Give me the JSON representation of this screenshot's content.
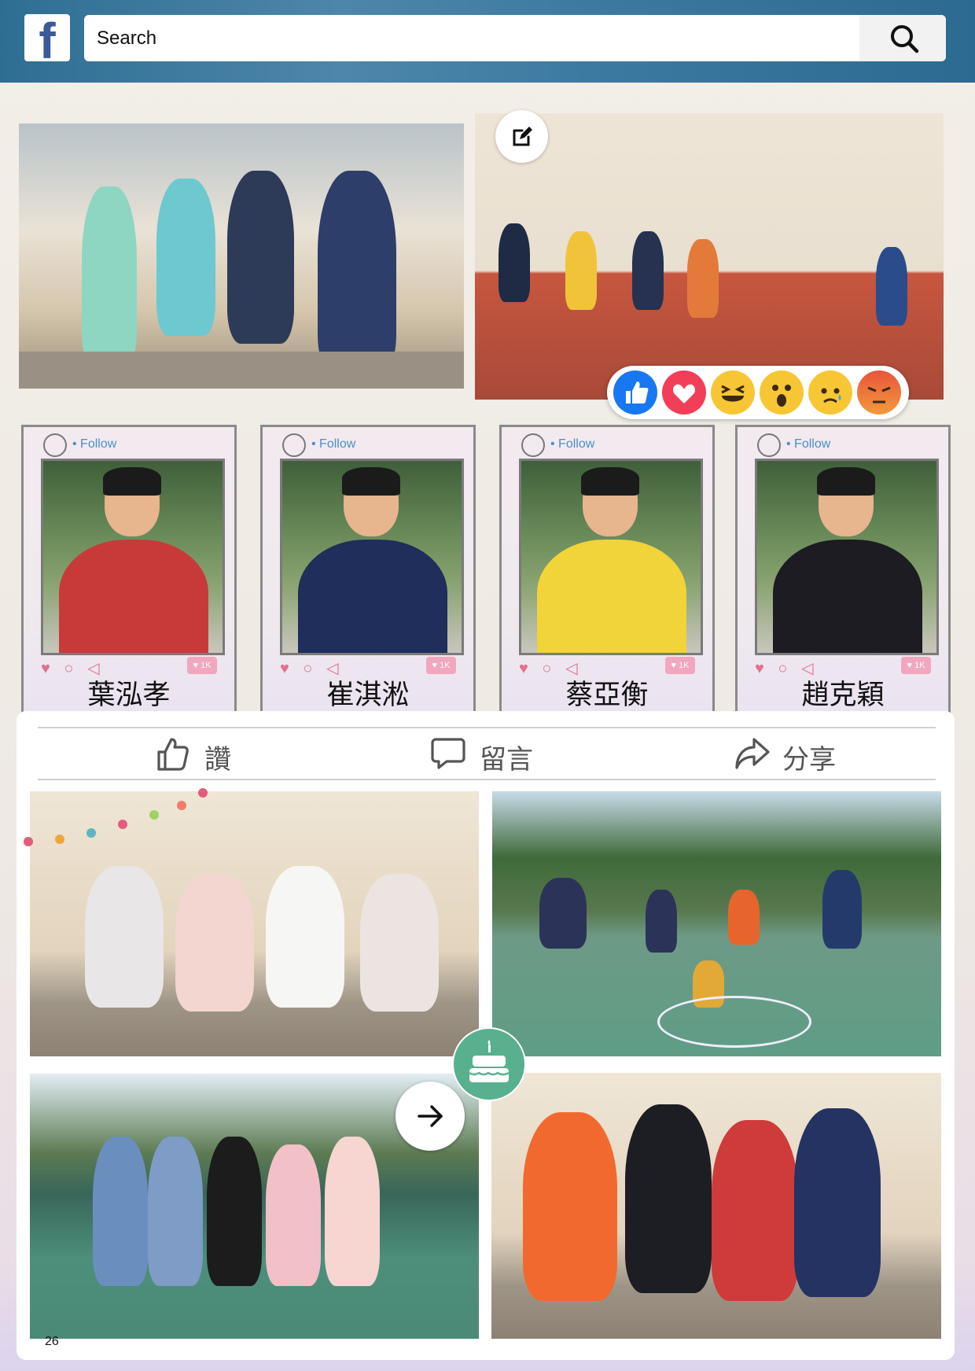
{
  "search": {
    "placeholder": "Search"
  },
  "icons": {
    "logo": "facebook-logo",
    "search": "magnifier-icon",
    "edit": "edit-icon",
    "like": "thumbs-up-icon",
    "comment": "comment-icon",
    "share": "share-icon",
    "cake": "birthday-cake-icon",
    "next": "arrow-right-icon"
  },
  "reactions": [
    "like",
    "love",
    "haha",
    "wow",
    "sad",
    "angry"
  ],
  "profiles": [
    {
      "follow": "Follow",
      "name": "葉泓孝",
      "likes": "1K"
    },
    {
      "follow": "Follow",
      "name": "崔淇淞",
      "likes": "1K"
    },
    {
      "follow": "Follow",
      "name": "蔡亞衡",
      "likes": "1K"
    },
    {
      "follow": "Follow",
      "name": "趙克穎",
      "likes": "1K"
    }
  ],
  "actions": {
    "like": "讚",
    "comment": "留言",
    "share": "分享"
  },
  "page_number": "26",
  "colors": {
    "facebook_blue": "#3b5998",
    "cake_badge": "#58b08f",
    "like_blue": "#1877f2",
    "love_red": "#f33e58"
  }
}
